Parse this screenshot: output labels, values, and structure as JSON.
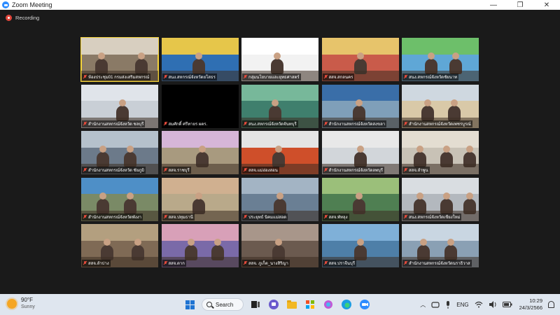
{
  "window": {
    "title": "Zoom Meeting",
    "minimize": "—",
    "maximize": "❐",
    "close": "✕"
  },
  "recording": {
    "label": "Recording"
  },
  "participants": [
    {
      "name": "ห้องประชุม01 กรมส่งเสริมสหกรณ์",
      "speaking": true,
      "bg": "#8a7a66",
      "banner": "#d8cfc0"
    },
    {
      "name": "สนง.สหกรณ์จังหวัดยโสธร",
      "speaking": false,
      "bg": "#2f6fb3",
      "banner": "#e6c64a"
    },
    {
      "name": "กลุ่มนโยบายและยุทธศาสตร์",
      "speaking": false,
      "bg": "#f2f2f2",
      "banner": "#ffffff"
    },
    {
      "name": "สสจ.สกลนคร",
      "speaking": false,
      "bg": "#c95b4a",
      "banner": "#e7c46b"
    },
    {
      "name": "สนง.สหกรณ์จังหวัดชัยนาท",
      "speaking": false,
      "bg": "#5fa7d6",
      "banner": "#6dbf6a"
    },
    {
      "name": "สำนักงานสหกรณ์จังหวัด ชลบุรี",
      "speaking": false,
      "bg": "#c9cfd6",
      "banner": "#e0e4ea"
    },
    {
      "name": "สมศักดิ์ ศรีทายร ผตร.",
      "speaking": false,
      "bg": "#000000",
      "banner": "#000000"
    },
    {
      "name": "สนง.สหกรณ์จังหวัดจันทบุรี",
      "speaking": false,
      "bg": "#3f7f6d",
      "banner": "#77b89a"
    },
    {
      "name": "สำนักงานสหกรณ์จังหวัดสงขลา",
      "speaking": false,
      "bg": "#7f9fb9",
      "banner": "#3a6ea8"
    },
    {
      "name": "สำนักงานสหกรณ์จังหวัดเพชรบูรณ์",
      "speaking": false,
      "bg": "#d9c9a8",
      "banner": "#cfd8e0"
    },
    {
      "name": "สำนักงานสหกรณ์จังหวัด ชัยภูมิ",
      "speaking": false,
      "bg": "#6c7a8a",
      "banner": "#b5c1cc"
    },
    {
      "name": "สสจ.ราชบุรี",
      "speaking": false,
      "bg": "#a89a7f",
      "banner": "#d6b6d8"
    },
    {
      "name": "สสจ.แม่ฮ่องสอน",
      "speaking": false,
      "bg": "#cf4f2a",
      "banner": "#e4e4e4"
    },
    {
      "name": "สำนักงานสหกรณ์จังหวัดลพบุรี",
      "speaking": false,
      "bg": "#d2d6da",
      "banner": "#e8e8e8"
    },
    {
      "name": "สสจ.ลำพูน",
      "speaking": false,
      "bg": "#c8c2b6",
      "banner": "#e3ddd1"
    },
    {
      "name": "สำนักงานสหกรณ์จังหวัดพังงา",
      "speaking": false,
      "bg": "#7a8a66",
      "banner": "#4e8fc7"
    },
    {
      "name": "สสจ.ปทุมธานี",
      "speaking": false,
      "bg": "#b9a98a",
      "banner": "#d0b090"
    },
    {
      "name": "ประยุทธ์ นิคมแม่สอด",
      "speaking": false,
      "bg": "#6a7f94",
      "banner": "#a3b4c4"
    },
    {
      "name": "สสจ.พัทลุง",
      "speaking": false,
      "bg": "#4f7f52",
      "banner": "#9bbf7a"
    },
    {
      "name": "สนง.สหกรณ์จังหวัดเชียงใหม่",
      "speaking": false,
      "bg": "#b3b8be",
      "banner": "#d9dde1"
    },
    {
      "name": "สสจ.ลำปาง",
      "speaking": false,
      "bg": "#7f6a55",
      "banner": "#b39f7f"
    },
    {
      "name": "สสจ.ตาก",
      "speaking": false,
      "bg": "#7a6aa8",
      "banner": "#d8a0b8"
    },
    {
      "name": "สสจ. ภูเก็ต_นางสิริญา",
      "speaking": false,
      "bg": "#6b5a4f",
      "banner": "#a8968a"
    },
    {
      "name": "สสจ.ปราจีนบุรี",
      "speaking": false,
      "bg": "#4e7fa8",
      "banner": "#7fb0d8"
    },
    {
      "name": "สำนักงานสหกรณ์จังหวัดนราธิวาส",
      "speaking": false,
      "bg": "#8aa0b4",
      "banner": "#c9d6e2"
    }
  ],
  "taskbar": {
    "weather": {
      "temp": "90°F",
      "condition": "Sunny"
    },
    "search_label": "Search",
    "language": "ENG",
    "time": "10:29",
    "date": "24/3/2566"
  },
  "colors": {
    "speaking_outline": "#f5d33a",
    "mic_muted": "#e24a3b",
    "zoom_blue": "#2d8cff"
  }
}
